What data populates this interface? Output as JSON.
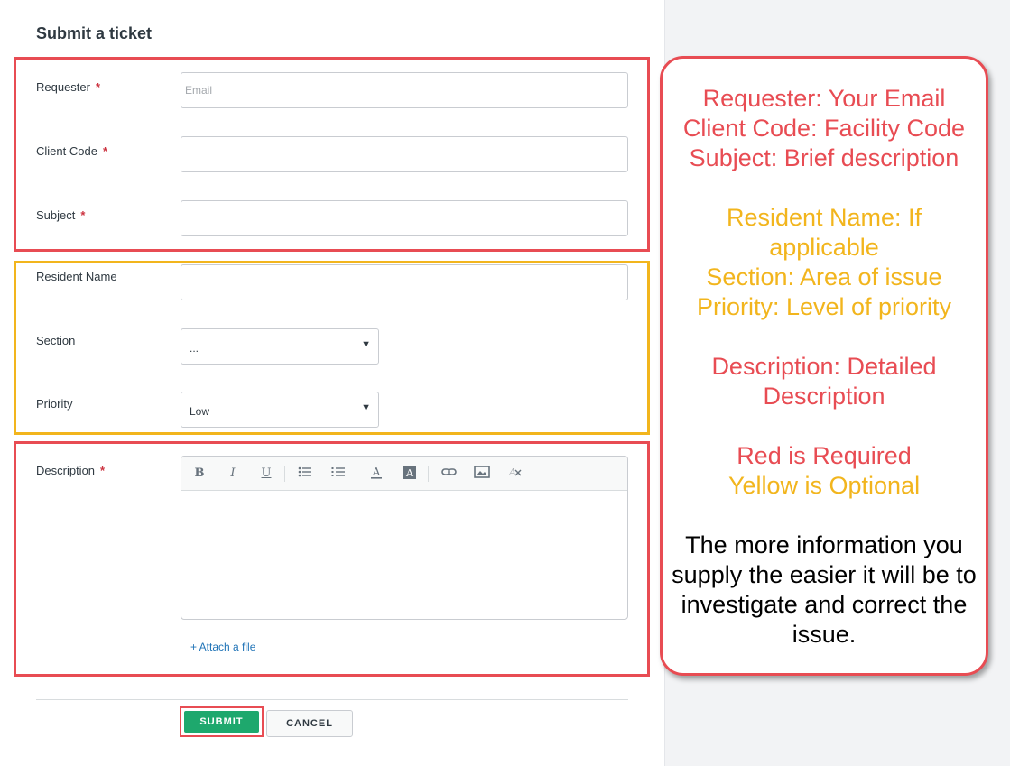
{
  "page": {
    "title": "Submit a ticket",
    "required_marker": "*"
  },
  "fields": {
    "requester": {
      "label": "Requester",
      "placeholder": "Email",
      "value": ""
    },
    "client_code": {
      "label": "Client Code",
      "value": ""
    },
    "subject": {
      "label": "Subject",
      "value": ""
    },
    "resident_name": {
      "label": "Resident Name",
      "value": ""
    },
    "section": {
      "label": "Section",
      "selected": "..."
    },
    "priority": {
      "label": "Priority",
      "selected": "Low"
    },
    "description": {
      "label": "Description"
    }
  },
  "editor_toolbar": {
    "bold": "B",
    "italic": "I",
    "underline": "U",
    "icons": [
      "bold-icon",
      "italic-icon",
      "underline-icon",
      "bulleted-list-icon",
      "numbered-list-icon",
      "font-color-icon",
      "background-color-icon",
      "link-icon",
      "image-icon",
      "clear-format-icon"
    ]
  },
  "attach": {
    "label": "+ Attach a file"
  },
  "buttons": {
    "submit": "SUBMIT",
    "cancel": "CANCEL"
  },
  "callout": {
    "required_lines": [
      "Requester: Your Email",
      "Client Code: Facility Code",
      "Subject: Brief description"
    ],
    "optional_lines": [
      "Resident Name: If applicable",
      "Section: Area of issue",
      "Priority: Level of priority"
    ],
    "description_line": "Description: Detailed Description",
    "legend_required": "Red is Required",
    "legend_optional": "Yellow is Optional",
    "note": "The more information you supply the easier it will be to investigate and correct the issue."
  },
  "colors": {
    "required": "#e84c53",
    "optional": "#f2b51d",
    "submit_bg": "#1ea86d",
    "link": "#1f73b7"
  }
}
